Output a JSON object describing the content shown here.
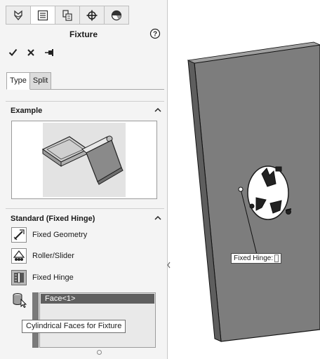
{
  "property_manager": {
    "title": "Fixture",
    "tabs": [
      {
        "name": "feature-manager-icon",
        "active": false
      },
      {
        "name": "property-manager-icon",
        "active": true
      },
      {
        "name": "configuration-manager-icon",
        "active": false
      },
      {
        "name": "dimxpert-icon",
        "active": false
      },
      {
        "name": "display-manager-icon",
        "active": false
      }
    ],
    "actions": [
      "ok-checkmark-icon",
      "cancel-x-icon",
      "pushpin-icon"
    ],
    "subtabs": [
      {
        "label": "Type",
        "active": true
      },
      {
        "label": "Split",
        "active": false
      }
    ],
    "example": {
      "header": "Example",
      "image_icon": "fixed-hinge-example-image"
    },
    "standard": {
      "header": "Standard (Fixed Hinge)",
      "options": [
        {
          "label": "Fixed Geometry",
          "icon": "fixed-geometry-icon",
          "selected": false
        },
        {
          "label": "Roller/Slider",
          "icon": "roller-slider-icon",
          "selected": false
        },
        {
          "label": "Fixed Hinge",
          "icon": "fixed-hinge-icon",
          "selected": true
        }
      ],
      "faces_icon": "cylinder-face-icon",
      "face_items": [
        "Face<1>"
      ],
      "tooltip": "Cylindrical Faces for Fixture"
    }
  },
  "viewport": {
    "callout_label": "Fixed Hinge:",
    "plate_color": "#7d7d7d",
    "hole_color": "#ffffff"
  },
  "colors": {
    "panel_bg": "#f4f4f4",
    "selection_bg": "#5f5f5f",
    "list_bg": "#e9e9e9"
  }
}
